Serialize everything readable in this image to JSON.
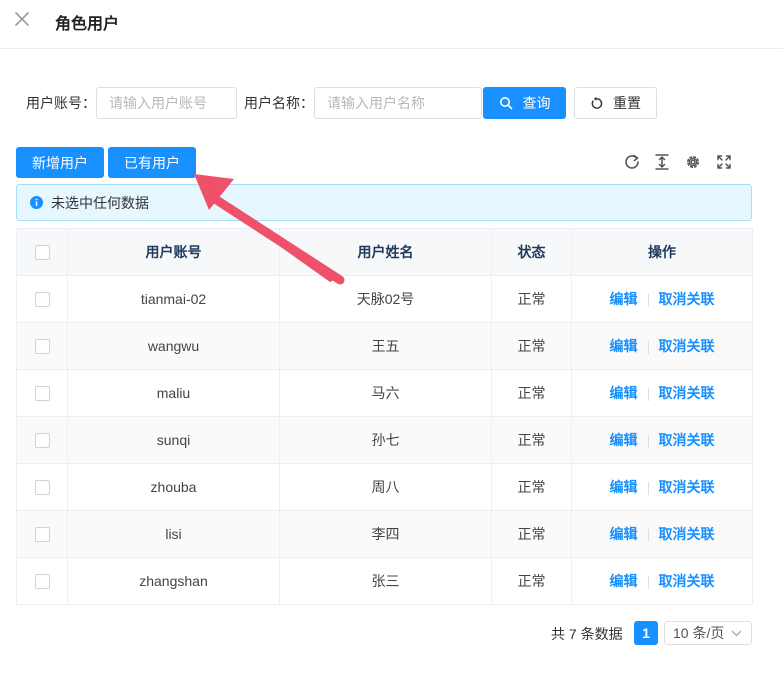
{
  "header": {
    "title": "角色用户",
    "close_icon": "close-icon"
  },
  "search": {
    "account_label": "用户账号：",
    "account_placeholder": "请输入用户账号",
    "name_label": "用户名称：",
    "name_placeholder": "请输入用户名称",
    "query_label": "查询",
    "reset_label": "重置"
  },
  "toolbar": {
    "add_label": "新增用户",
    "existing_label": "已有用户",
    "icons": [
      "refresh-icon",
      "column-height-icon",
      "gear-icon",
      "fullscreen-icon"
    ]
  },
  "alert": {
    "text": "未选中任何数据",
    "icon": "info-icon"
  },
  "table": {
    "columns": [
      "用户账号",
      "用户姓名",
      "状态",
      "操作"
    ],
    "actions": {
      "edit": "编辑",
      "unlink": "取消关联"
    },
    "rows": [
      {
        "account": "tianmai-02",
        "name": "天脉02号",
        "status": "正常"
      },
      {
        "account": "wangwu",
        "name": "王五",
        "status": "正常"
      },
      {
        "account": "maliu",
        "name": "马六",
        "status": "正常"
      },
      {
        "account": "sunqi",
        "name": "孙七",
        "status": "正常"
      },
      {
        "account": "zhouba",
        "name": "周八",
        "status": "正常"
      },
      {
        "account": "lisi",
        "name": "李四",
        "status": "正常"
      },
      {
        "account": "zhangshan",
        "name": "张三",
        "status": "正常"
      }
    ]
  },
  "pager": {
    "total_text": "共 7 条数据",
    "current_page": "1",
    "page_size": "10 条/页"
  },
  "colors": {
    "primary": "#1890ff",
    "alert_bg": "#e6f7ff",
    "annotation_arrow": "#f0516a"
  }
}
